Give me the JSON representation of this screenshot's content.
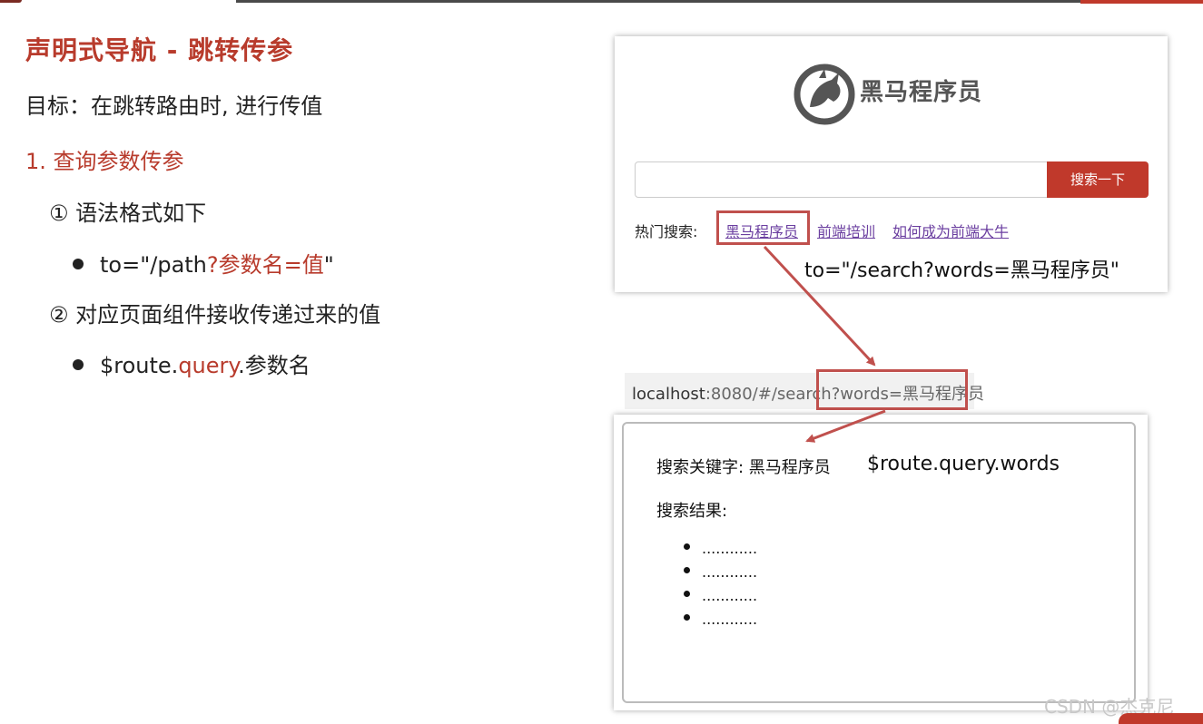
{
  "slide": {
    "title": "声明式导航 - 跳转传参",
    "goal": "目标：在跳转路由时, 进行传值",
    "section1": "1. 查询参数传参",
    "sub1": "① 语法格式如下",
    "bullet1_prefix": "to=\"/path",
    "bullet1_red": "?参数名=值",
    "bullet1_suffix": "\"",
    "sub2": "② 对应页面组件接收传递过来的值",
    "bullet2_prefix": "$route.",
    "bullet2_red": "query",
    "bullet2_suffix": ".参数名"
  },
  "search_page": {
    "logo_text": "黑马程序员",
    "search_button": "搜索一下",
    "search_input_value": "",
    "hot_label": "热门搜索:",
    "hot_links": [
      "黑马程序员",
      "前端培训",
      "如何成为前端大牛"
    ],
    "to_annotation": "to=\"/search?words=黑马程序员\""
  },
  "url_bar": {
    "host": "localhost",
    "path": ":8080/#/search",
    "query": "?words=黑马程序员"
  },
  "result_page": {
    "keyword_label": "搜索关键字: 黑马程序员",
    "keyword_expr": "$route.query.words",
    "results_label": "搜索结果:",
    "items": [
      "............",
      "............",
      "............",
      "............"
    ]
  },
  "watermark": "CSDN @杰克尼",
  "colors": {
    "accent": "#b83b2c",
    "highlight_box": "#c0504d",
    "link": "#6b3fa0"
  }
}
